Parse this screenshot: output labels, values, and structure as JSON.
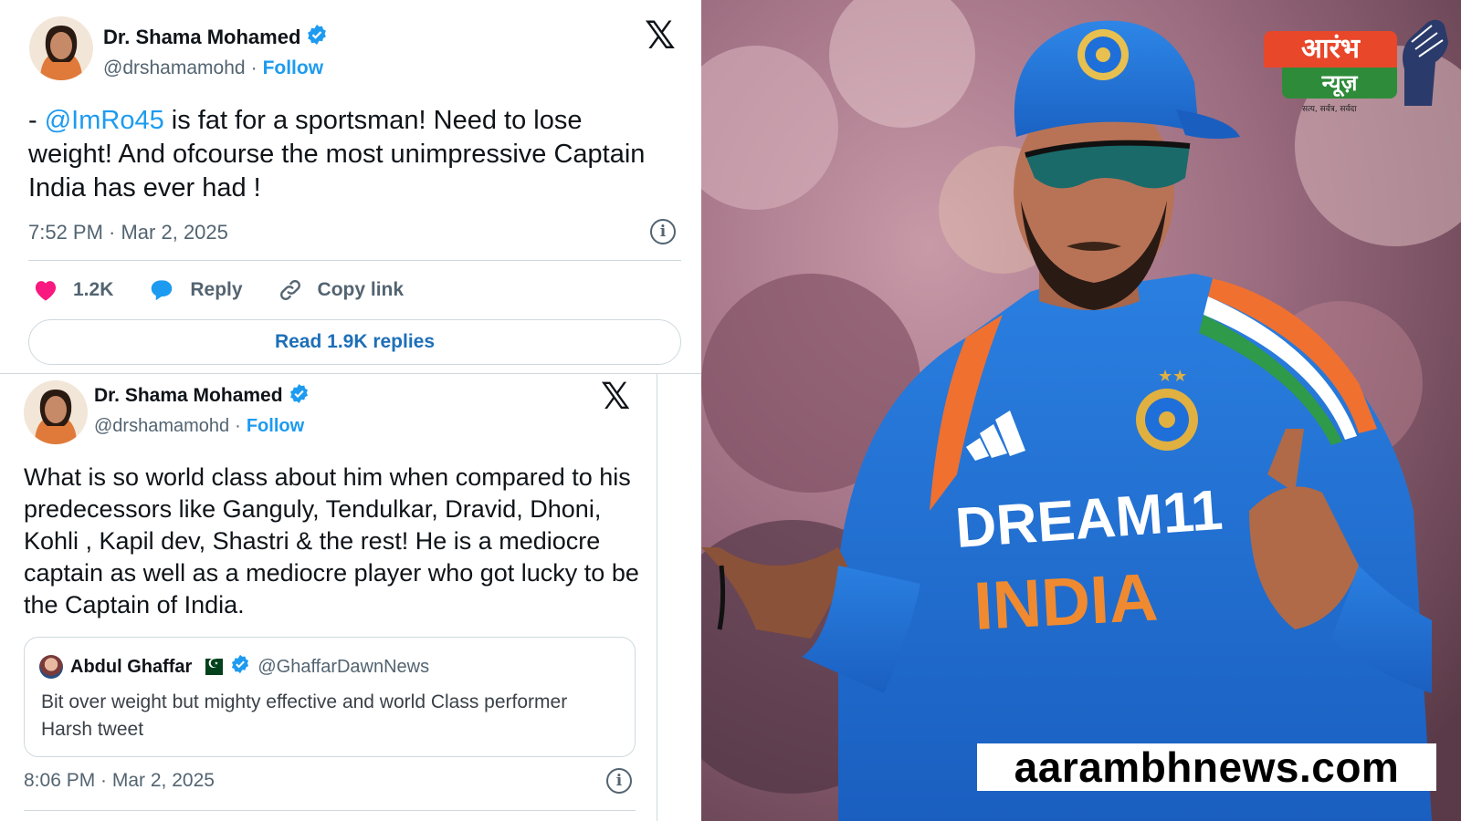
{
  "tweet1": {
    "author_name": "Dr. Shama Mohamed",
    "handle": "@drshamamohd",
    "separator": "·",
    "follow_label": "Follow",
    "text_prefix": "- ",
    "mention": "@ImRo45",
    "text_body": " is fat for a sportsman! Need to lose weight! And ofcourse the most unimpressive Captain India has ever had  !",
    "timestamp": "7:52 PM · Mar 2, 2025",
    "likes": "1.2K",
    "reply_label": "Reply",
    "copy_link_label": "Copy link",
    "read_replies_label": "Read 1.9K replies"
  },
  "tweet2": {
    "author_name": "Dr. Shama Mohamed",
    "handle": "@drshamamohd",
    "separator": "·",
    "follow_label": "Follow",
    "text": "What is so world class about him when compared to his predecessors like Ganguly, Tendulkar, Dravid, Dhoni, Kohli , Kapil dev, Shastri & the rest! He is a mediocre captain as well as a mediocre player who got lucky to be the Captain of India.",
    "quote": {
      "author_name": "Abdul Ghaffar",
      "handle": "@GhaffarDawnNews",
      "text_line1": "Bit over weight but mighty effective and world Class performer",
      "text_line2": "Harsh tweet"
    },
    "timestamp": "8:06 PM · Mar 2, 2025"
  },
  "photo": {
    "jersey_sponsor": "DREAM11",
    "jersey_country": "INDIA"
  },
  "logo": {
    "line1": "आरंभ",
    "line2": "न्यूज़",
    "tagline": "सत्य, सर्वत्र, सर्वदा"
  },
  "site_url": "aarambhnews.com",
  "colors": {
    "twitter_blue": "#1d9bf0",
    "like_pink": "#f91880",
    "text_gray": "#536471",
    "jersey_blue": "#1e6fd9",
    "logo_orange": "#e8472a",
    "logo_green": "#2e8b3a"
  },
  "icons": [
    "x-logo-icon",
    "verified-badge-icon",
    "info-icon",
    "heart-icon",
    "reply-bubble-icon",
    "link-icon"
  ]
}
